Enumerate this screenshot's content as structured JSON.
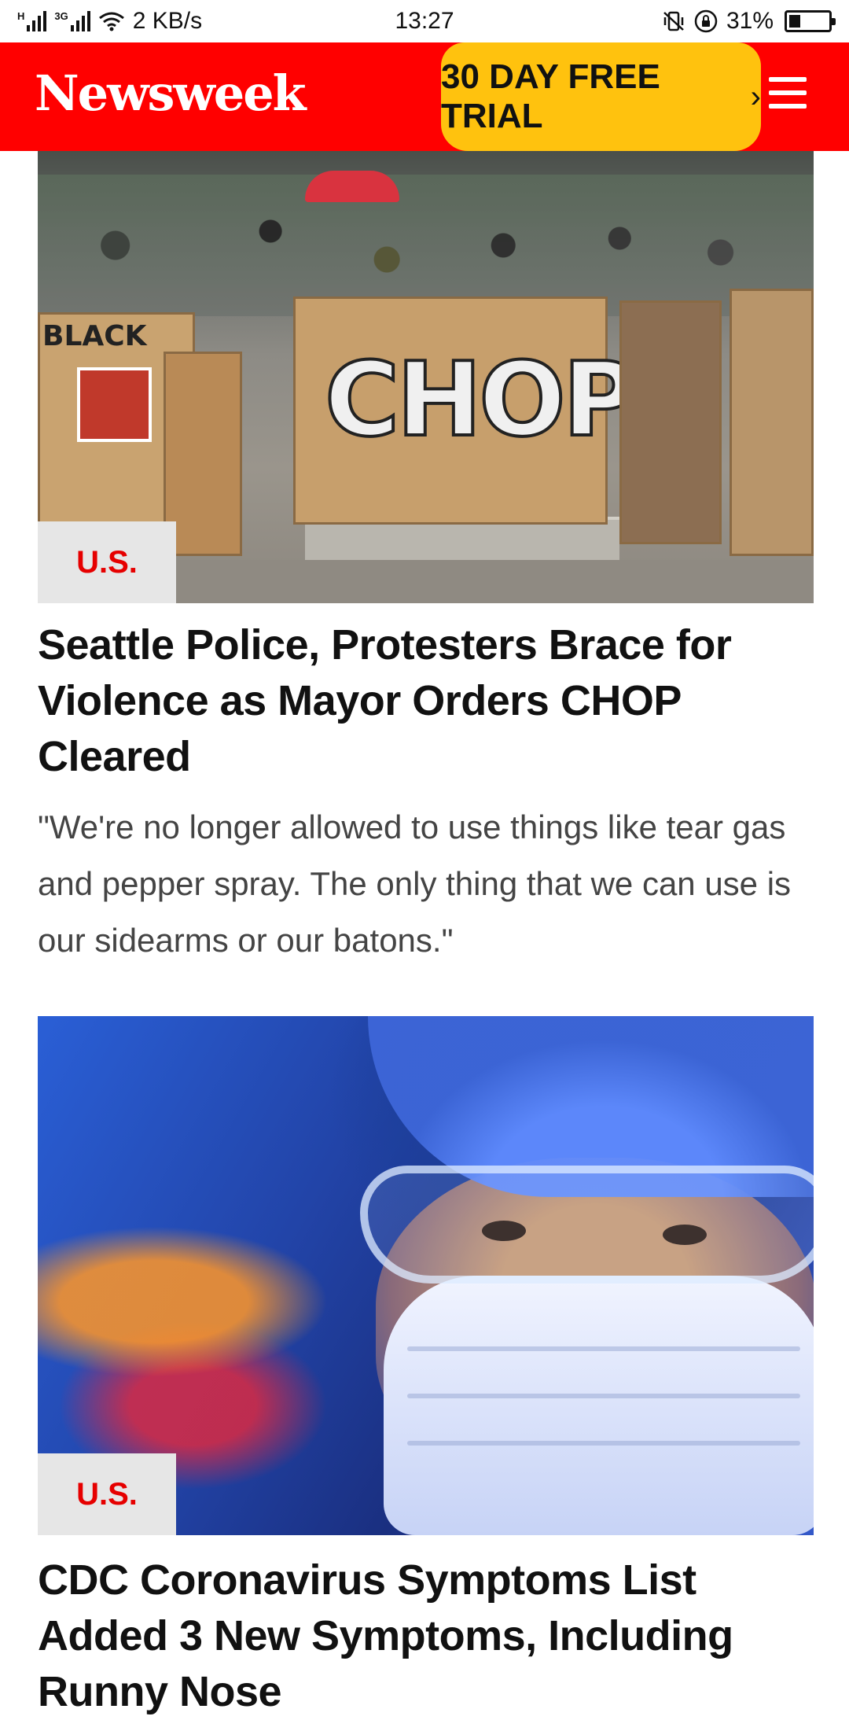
{
  "status_bar": {
    "signal_label_1": "H",
    "signal_label_2": "3G",
    "network_speed": "2 KB/s",
    "time": "13:27",
    "battery": "31%"
  },
  "header": {
    "logo": "Newsweek",
    "trial_label": "30 DAY FREE TRIAL",
    "trial_chevron": "›"
  },
  "articles": [
    {
      "category": "U.S.",
      "headline": "Seattle Police, Protesters Brace for Violence as Mayor Orders CHOP Cleared",
      "dek": "\"We're no longer allowed to use things like tear gas and pepper spray. The only thing that we can use is our sidearms or our batons.\"",
      "image_text": {
        "board_left": "BLACK",
        "board_center": "CHOP"
      }
    },
    {
      "category": "U.S.",
      "headline": "CDC Coronavirus Symptoms List Added 3 New Symptoms, Including Runny Nose"
    }
  ],
  "colors": {
    "brand_red": "#ff0000",
    "trial_yellow": "#ffc20e",
    "category_red": "#e60000",
    "tag_bg": "#e6e6e6"
  },
  "icons": {
    "menu": "hamburger-menu-icon",
    "wifi": "wifi-icon",
    "battery": "battery-icon",
    "vibrate": "vibrate-icon",
    "rotation_lock": "rotation-lock-icon"
  }
}
